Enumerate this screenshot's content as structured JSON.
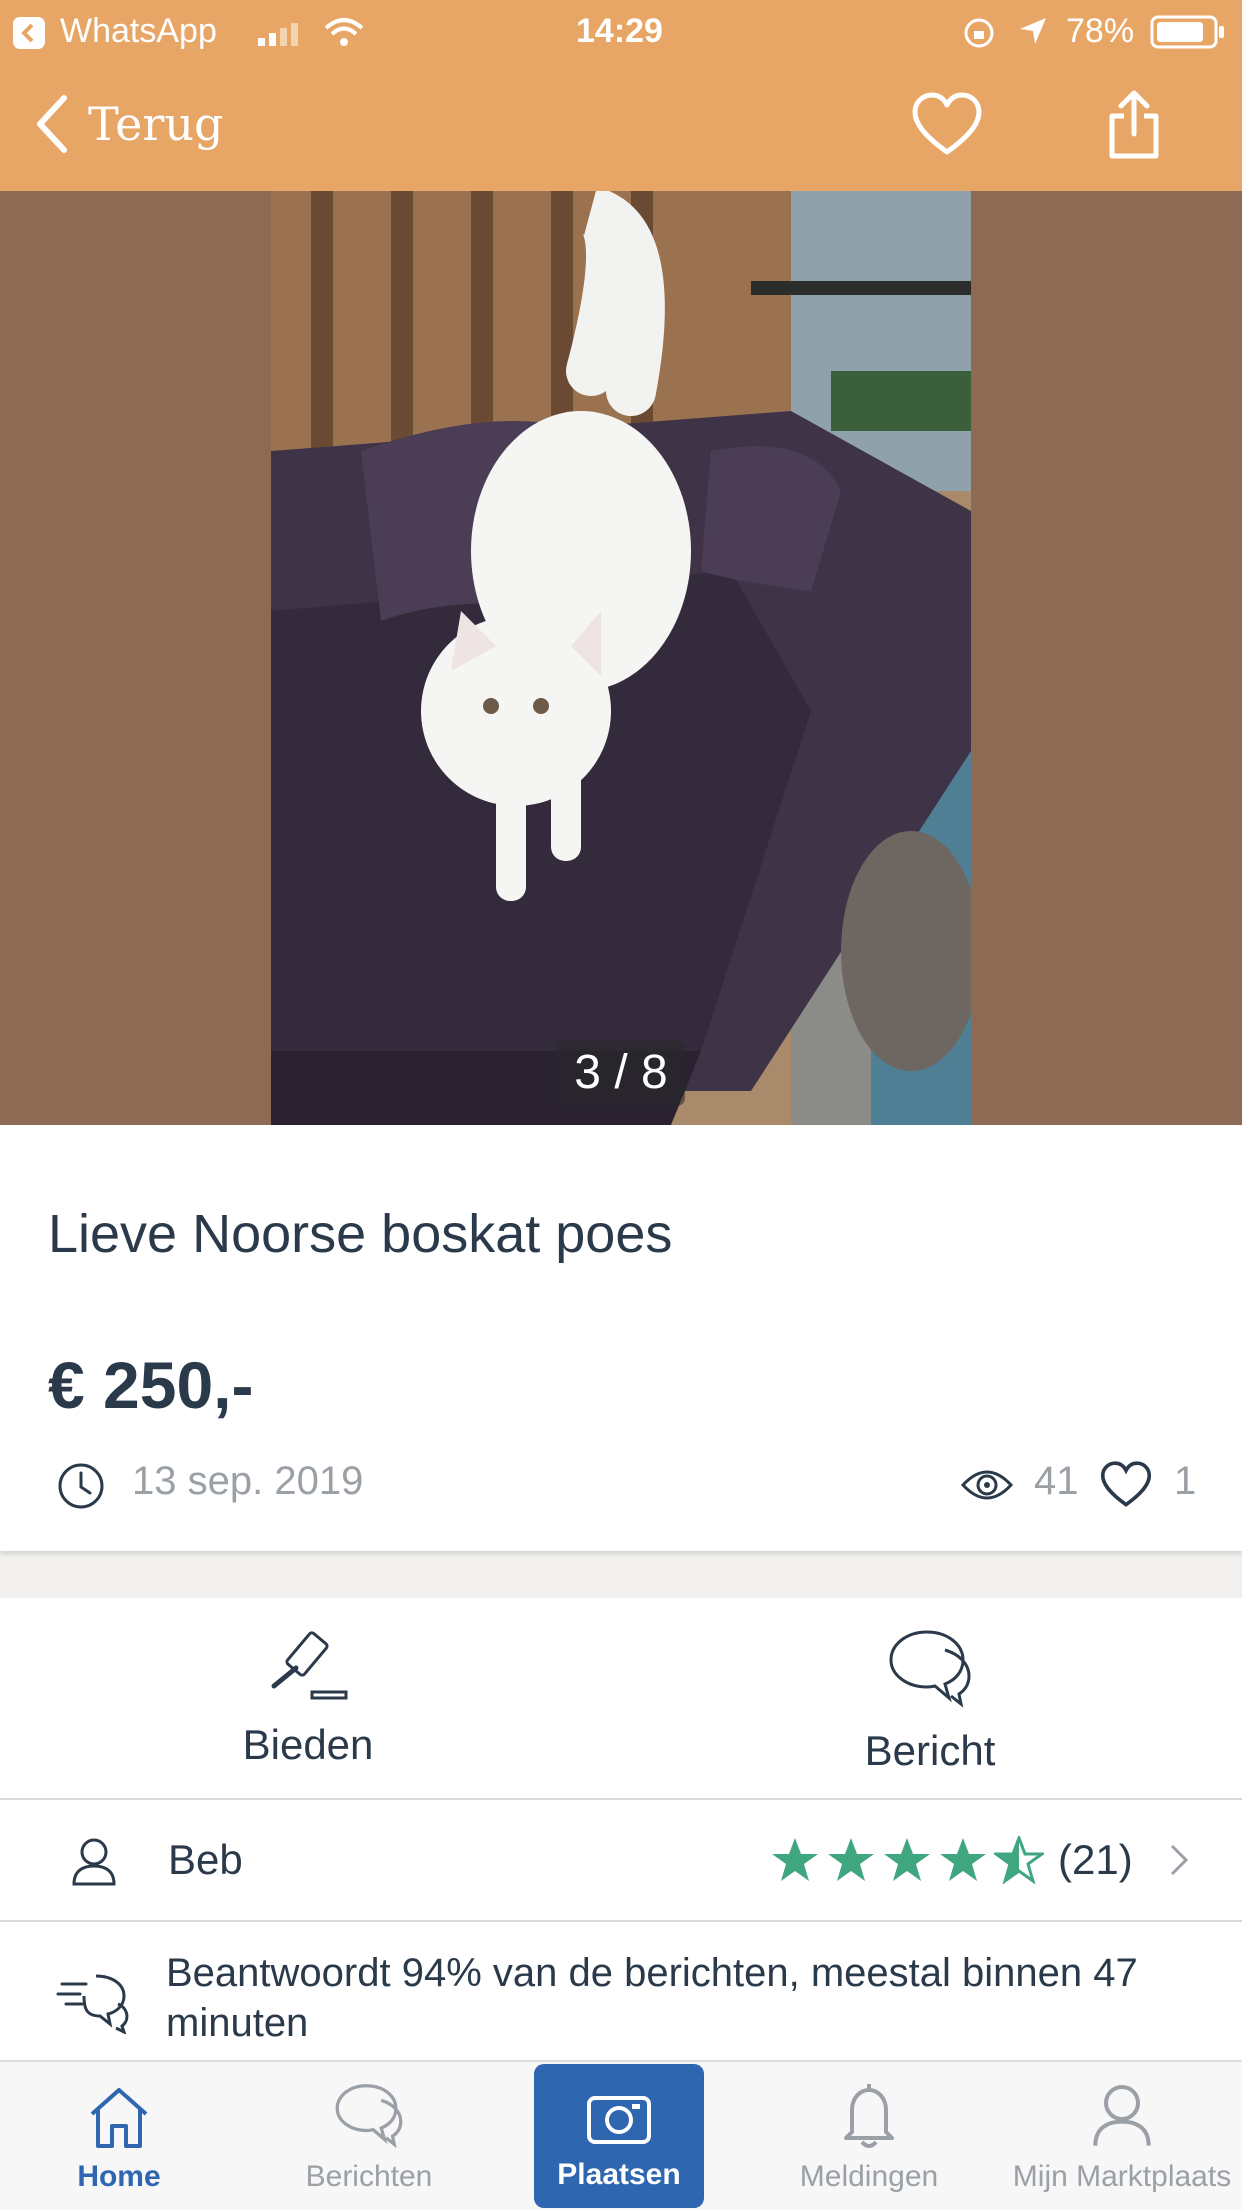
{
  "status_bar": {
    "back_app": "WhatsApp",
    "time": "14:29",
    "battery": "78%"
  },
  "nav": {
    "back_label": "Terug"
  },
  "gallery": {
    "counter": "3 / 8"
  },
  "listing": {
    "title": "Lieve Noorse boskat poes",
    "price": "€ 250,-",
    "date": "13 sep. 2019",
    "views": "41",
    "favorites": "1"
  },
  "actions": {
    "bid_label": "Bieden",
    "message_label": "Bericht"
  },
  "seller": {
    "name": "Beb",
    "rating": 4.5,
    "rating_max": 5,
    "reviews": "(21)"
  },
  "response": {
    "text": "Beantwoordt 94% van de berichten, meestal binnen 47 minuten"
  },
  "tabs": [
    {
      "label": "Home"
    },
    {
      "label": "Berichten"
    },
    {
      "label": "Plaatsen"
    },
    {
      "label": "Meldingen"
    },
    {
      "label": "Mijn Marktplaats"
    }
  ],
  "colors": {
    "header": "#e8a666",
    "accent": "#2e66b0",
    "star": "#3fa680"
  }
}
